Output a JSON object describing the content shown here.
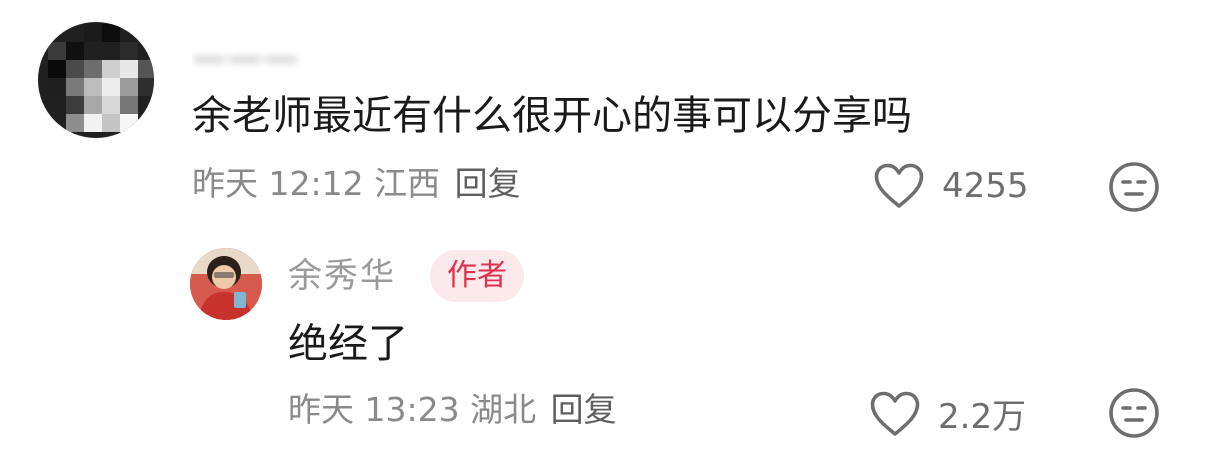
{
  "comment": {
    "username": "一一一",
    "text": "余老师最近有什么很开心的事可以分享吗",
    "meta_date": "昨天",
    "meta_time": "12:12",
    "meta_location": "江西",
    "reply_label": "回复",
    "like_count": "4255"
  },
  "reply": {
    "username": "余秀华",
    "badge": "作者",
    "text": "绝经了",
    "meta_date": "昨天",
    "meta_time": "13:23",
    "meta_location": "湖北",
    "reply_label": "回复",
    "like_count": "2.2万"
  },
  "icons": {
    "like": "heart-outline-icon",
    "dislike": "meh-face-icon"
  },
  "colors": {
    "badge_bg": "#fbe9ec",
    "badge_text": "#e0304e",
    "meta_text": "#8a8a8a",
    "icon_stroke": "#6e6e6e"
  }
}
